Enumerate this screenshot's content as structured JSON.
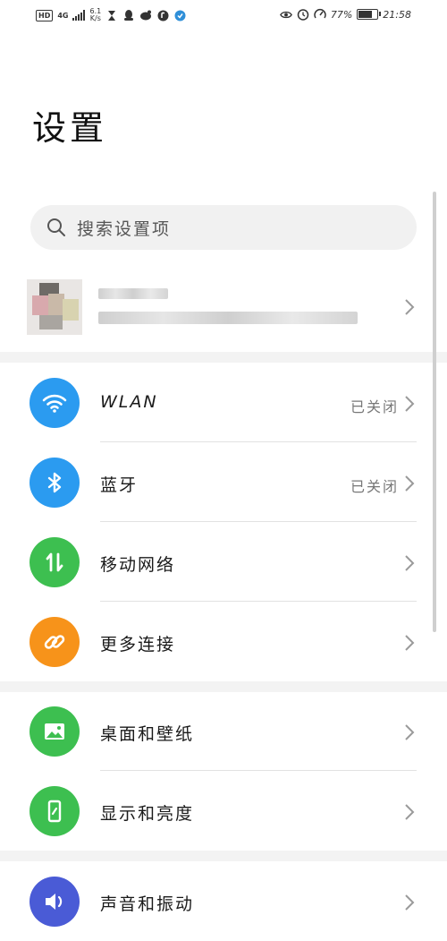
{
  "status_bar": {
    "hd": "HD",
    "network": "4G",
    "speed_value": "6.1",
    "speed_unit": "K/s",
    "battery_percent": "77%",
    "time": "21:58",
    "battery_level": 0.77
  },
  "page_title": "设置",
  "search": {
    "placeholder": "搜索设置项"
  },
  "account": {
    "name": "",
    "subtitle": ""
  },
  "groups": [
    {
      "items": [
        {
          "label": "WLAN",
          "value": "已关闭",
          "icon": "wifi-icon",
          "color": "#2b9bf0"
        },
        {
          "label": "蓝牙",
          "value": "已关闭",
          "icon": "bluetooth-icon",
          "color": "#2b9bf0"
        },
        {
          "label": "移动网络",
          "value": "",
          "icon": "mobile-data-icon",
          "color": "#3dbf50"
        },
        {
          "label": "更多连接",
          "value": "",
          "icon": "link-icon",
          "color": "#f7931a"
        }
      ]
    },
    {
      "items": [
        {
          "label": "桌面和壁纸",
          "value": "",
          "icon": "wallpaper-icon",
          "color": "#3dbf50"
        },
        {
          "label": "显示和亮度",
          "value": "",
          "icon": "display-icon",
          "color": "#3dbf50"
        }
      ]
    },
    {
      "items": [
        {
          "label": "声音和振动",
          "value": "",
          "icon": "sound-icon",
          "color": "#4a5bd6"
        }
      ]
    }
  ]
}
